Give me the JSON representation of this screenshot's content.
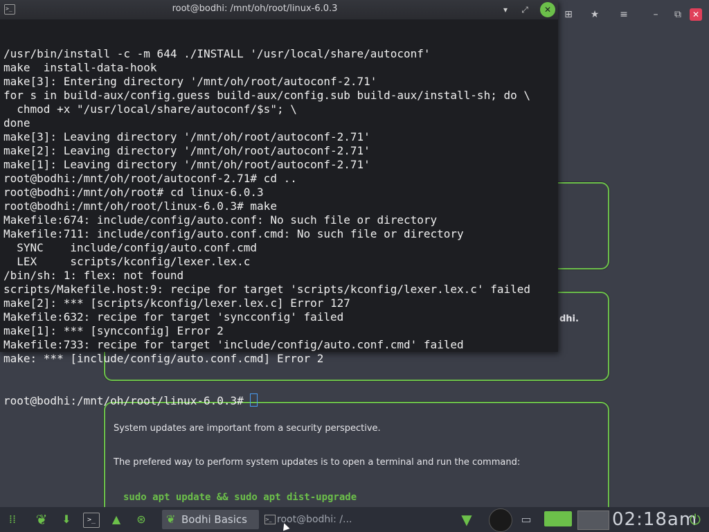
{
  "terminal": {
    "title": "root@bodhi: /mnt/oh/root/linux-6.0.3",
    "lines": [
      "/usr/bin/install -c -m 644 ./INSTALL '/usr/local/share/autoconf'",
      "make  install-data-hook",
      "make[3]: Entering directory '/mnt/oh/root/autoconf-2.71'",
      "for s in build-aux/config.guess build-aux/config.sub build-aux/install-sh; do \\",
      "  chmod +x \"/usr/local/share/autoconf/$s\"; \\",
      "done",
      "make[3]: Leaving directory '/mnt/oh/root/autoconf-2.71'",
      "make[2]: Leaving directory '/mnt/oh/root/autoconf-2.71'",
      "make[1]: Leaving directory '/mnt/oh/root/autoconf-2.71'",
      "root@bodhi:/mnt/oh/root/autoconf-2.71# cd ..",
      "root@bodhi:/mnt/oh/root# cd linux-6.0.3",
      "root@bodhi:/mnt/oh/root/linux-6.0.3# make",
      "Makefile:674: include/config/auto.conf: No such file or directory",
      "Makefile:711: include/config/auto.conf.cmd: No such file or directory",
      "  SYNC    include/config/auto.conf.cmd",
      "  LEX     scripts/kconfig/lexer.lex.c",
      "/bin/sh: 1: flex: not found",
      "scripts/Makefile.host:9: recipe for target 'scripts/kconfig/lexer.lex.c' failed",
      "make[2]: *** [scripts/kconfig/lexer.lex.c] Error 127",
      "Makefile:632: recipe for target 'syncconfig' failed",
      "make[1]: *** [syncconfig] Error 2",
      "Makefile:733: recipe for target 'include/config/auto.conf.cmd' failed",
      "make: *** [include/config/auto.conf.cmd] Error 2"
    ],
    "prompt": "root@bodhi:/mnt/oh/root/linux-6.0.3# "
  },
  "page": {
    "card2_tail": "dhi.",
    "card3_p1": "System updates are important from a security perspective.",
    "card3_p2": "The prefered way to perform system updates is to open a terminal and run the command:",
    "card3_cmd": "sudo apt update && sudo apt dist-upgrade"
  },
  "taskbar": {
    "task1": "Bodhi Basics",
    "task2": "root@bodhi: /...",
    "clock": "02:18am"
  },
  "colors": {
    "accent": "#6cc04a",
    "terminal_bg": "#1d1e22",
    "page_bg": "#3c3f49"
  },
  "icons": [
    "terminal-icon",
    "minimize-icon",
    "maximize-icon",
    "close-icon",
    "bodhi-leaf-icon",
    "files-icon",
    "appcenter-icon",
    "install-icon",
    "wifi-icon",
    "disc-icon",
    "clipboard-icon",
    "battery-icon",
    "workspace-pager-icon",
    "power-icon",
    "new-tab-icon",
    "bookmark-icon",
    "menu-icon"
  ]
}
